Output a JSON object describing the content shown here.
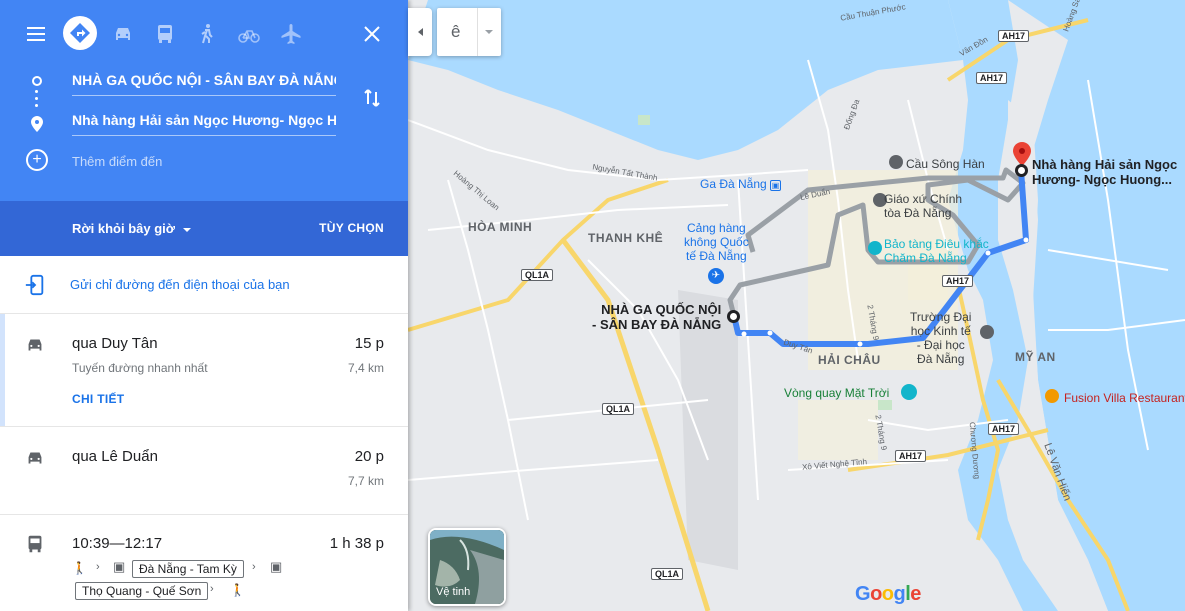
{
  "travel_modes": [
    {
      "name": "best",
      "icon": "directions-icon",
      "active": true
    },
    {
      "name": "driving",
      "icon": "car-icon",
      "active": false
    },
    {
      "name": "transit",
      "icon": "bus-icon",
      "active": false
    },
    {
      "name": "walking",
      "icon": "walk-icon",
      "active": false
    },
    {
      "name": "cycling",
      "icon": "bicycle-icon",
      "active": false
    },
    {
      "name": "flight",
      "icon": "airplane-icon",
      "active": false
    }
  ],
  "directions": {
    "origin": "NHÀ GA QUỐC NỘI - SÂN BAY ĐÀ NẴNG",
    "destination": "Nhà hàng Hải sản Ngọc Hương- Ngọc Hương",
    "add_stop": "Thêm điểm đến",
    "depart_label": "Rời khỏi bây giờ",
    "options_label": "TÙY CHỌN",
    "send_to_phone": "Gửi chỉ đường đến điện thoại của bạn"
  },
  "routes": [
    {
      "title": "qua Duy Tân",
      "time": "15 p",
      "subtitle": "Tuyến đường nhanh nhất",
      "distance": "7,4 km",
      "detail": "CHI TIẾT"
    },
    {
      "title": "qua Lê Duẩn",
      "time": "20 p",
      "distance": "7,7 km"
    },
    {
      "title": "10:39—12:17",
      "time": "1 h 38 p",
      "bus1": "Đà Nẵng - Tam Kỳ",
      "bus2": "Thọ Quang - Quế Sơn"
    }
  ],
  "map": {
    "areas": [
      "HÒA MINH",
      "THANH KHÊ",
      "HẢI CHÂU",
      "MỸ AN"
    ],
    "origin_label": "NHÀ GA QUỐC NỘI\n- SÂN BAY ĐÀ NẴNG",
    "destination_label": "Nhà hàng Hải sản Ngọc\nHương- Ngọc Huong...",
    "pois": {
      "ga": "Ga Đà Nẵng",
      "airport": "Cảng hàng\nkhông Quốc\ntế Đà Nẵng",
      "bridge": "Cầu Sông Hàn",
      "gov": "Giáo xứ Chính\ntòa Đà Nẵng",
      "museum": "Bảo tàng Điêu khắc\nChăm Đà Nẵng",
      "university": "Trường Đại\nhọc Kinh tế\n- Đại học\nĐà Nẵng",
      "ferris": "Vòng quay Mặt Trời",
      "fusion": "Fusion Villa Restaurant"
    },
    "streets": {
      "cau_thuan_phuoc": "Cầu Thuận Phước",
      "van_don": "Vân Đồn",
      "dong_da": "Đống Đa",
      "nguyen_tat_thanh": "Nguyễn Tất Thành",
      "hoang_thi_loan": "Hoàng Thị Loan",
      "le_duan": "Lê Duẩn",
      "duy_tan": "Duy Tân",
      "hai_thang_chin": "2 Tháng 9",
      "xo_viet": "Xô Viết Nghệ Tĩnh",
      "le_van_hien": "Lê Văn Hiến",
      "chuong_duong": "Chương Dương",
      "hoang_sa": "Hoàng Sa"
    },
    "shields": {
      "ah17": "AH17",
      "ql1a": "QL1A"
    },
    "satellite_label": "Vệ tinh",
    "layer_button_glyph": "ê",
    "logo": "Google"
  },
  "colors": {
    "header": "#4285f4",
    "depart_bar": "#3367d6",
    "route": "#4285f4",
    "alt_route": "#9aa0a6",
    "water": "#aadaff",
    "land": "#e8eaed",
    "park": "#c8e6c9",
    "urban": "#f5f0d8"
  }
}
